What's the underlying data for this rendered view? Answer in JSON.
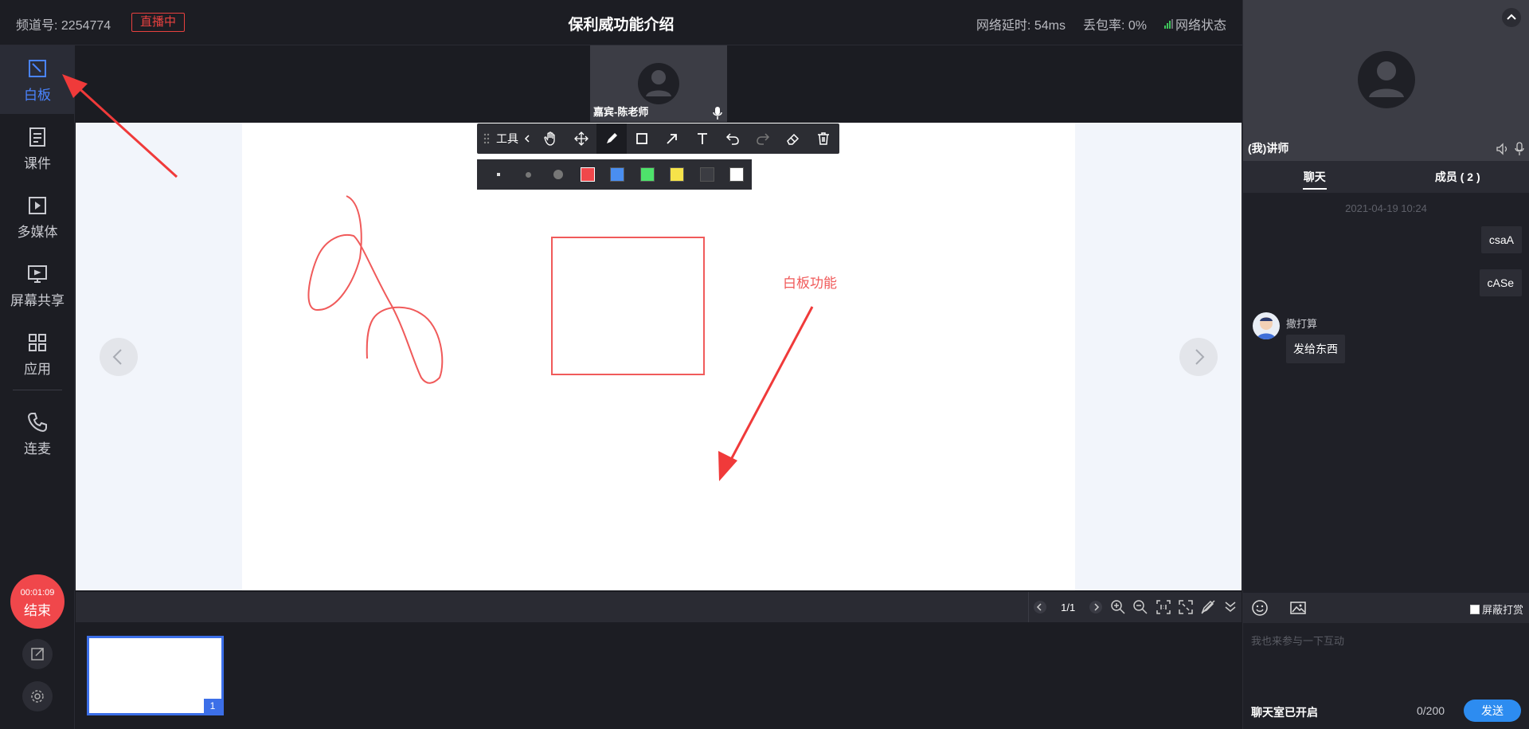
{
  "header": {
    "channel": "频道号: 2254774",
    "live_badge": "直播中",
    "title": "保利威功能介绍",
    "latency": "网络延时: 54ms",
    "packet_loss": "丢包率: 0%",
    "network_status": "网络状态"
  },
  "sidebar": {
    "items": [
      {
        "label": "白板",
        "icon": "whiteboard-icon",
        "active": true
      },
      {
        "label": "课件",
        "icon": "document-icon"
      },
      {
        "label": "多媒体",
        "icon": "media-play-icon"
      },
      {
        "label": "屏幕共享",
        "icon": "screen-share-icon"
      },
      {
        "label": "应用",
        "icon": "apps-grid-icon"
      },
      {
        "label": "连麦",
        "icon": "phone-icon"
      }
    ],
    "timer": "00:01:09",
    "end_label": "结束"
  },
  "guest": {
    "name": "嘉宾-陈老师"
  },
  "toolbar": {
    "label": "工具",
    "tools": [
      "hand-icon",
      "move-icon",
      "pen-icon",
      "rectangle-icon",
      "arrow-icon",
      "text-icon",
      "undo-icon",
      "redo-icon",
      "eraser-icon",
      "trash-icon"
    ],
    "active_tool": "pen-icon"
  },
  "palette": {
    "colors": [
      "#f0474b",
      "#4a8ef0",
      "#4ee36b",
      "#f6e34a",
      "#3b3c42",
      "#ffffff"
    ],
    "selected_color": "#f0474b"
  },
  "board": {
    "annotation": "白板功能",
    "stroke_color": "#f05a5a"
  },
  "controls": {
    "page": "1/1"
  },
  "thumbnails": [
    {
      "num": "1"
    }
  ],
  "teacher": {
    "name": "(我)讲师"
  },
  "chat": {
    "tabs": [
      "聊天",
      "成员 ( 2 )"
    ],
    "timestamp": "2021-04-19 10:24",
    "my_messages": [
      "csaA",
      "cASe"
    ],
    "other": {
      "name": "撒打算",
      "message": "发给东西"
    },
    "block_gift": "屏蔽打赏",
    "placeholder": "我也来参与一下互动",
    "status": "聊天室已开启",
    "count": "0/200",
    "send": "发送"
  }
}
